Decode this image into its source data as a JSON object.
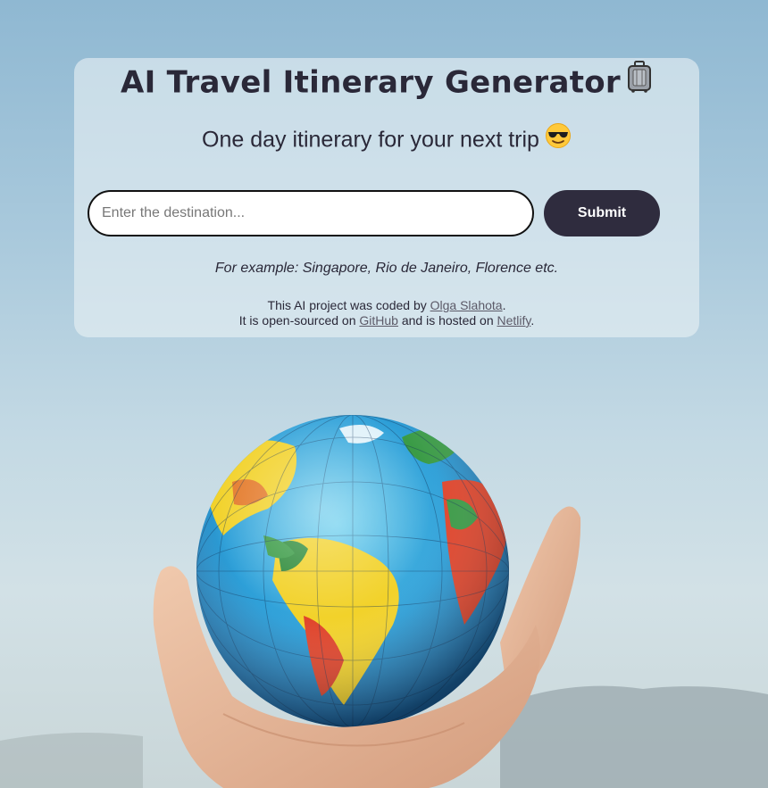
{
  "header": {
    "title": "AI Travel Itinerary Generator",
    "title_icon": "luggage-icon",
    "subtitle": "One day itinerary for your next trip",
    "subtitle_icon": "sunglasses-face-icon"
  },
  "form": {
    "destination_placeholder": "Enter the destination...",
    "destination_value": "",
    "submit_label": "Submit"
  },
  "hint": "For example: Singapore, Rio de Janeiro, Florence etc.",
  "footer": {
    "line1_prefix": "This AI project was coded by ",
    "author_link": "Olga Slahota",
    "line1_suffix": ".",
    "line2_prefix": "It is open-sourced on ",
    "github_link": "GitHub",
    "line2_middle": " and is hosted on ",
    "netlify_link": "Netlify",
    "line2_suffix": "."
  },
  "colors": {
    "card_text": "#2a2838",
    "button_bg": "#2f2c3e",
    "button_text": "#ffffff",
    "link": "#5c5a68"
  }
}
